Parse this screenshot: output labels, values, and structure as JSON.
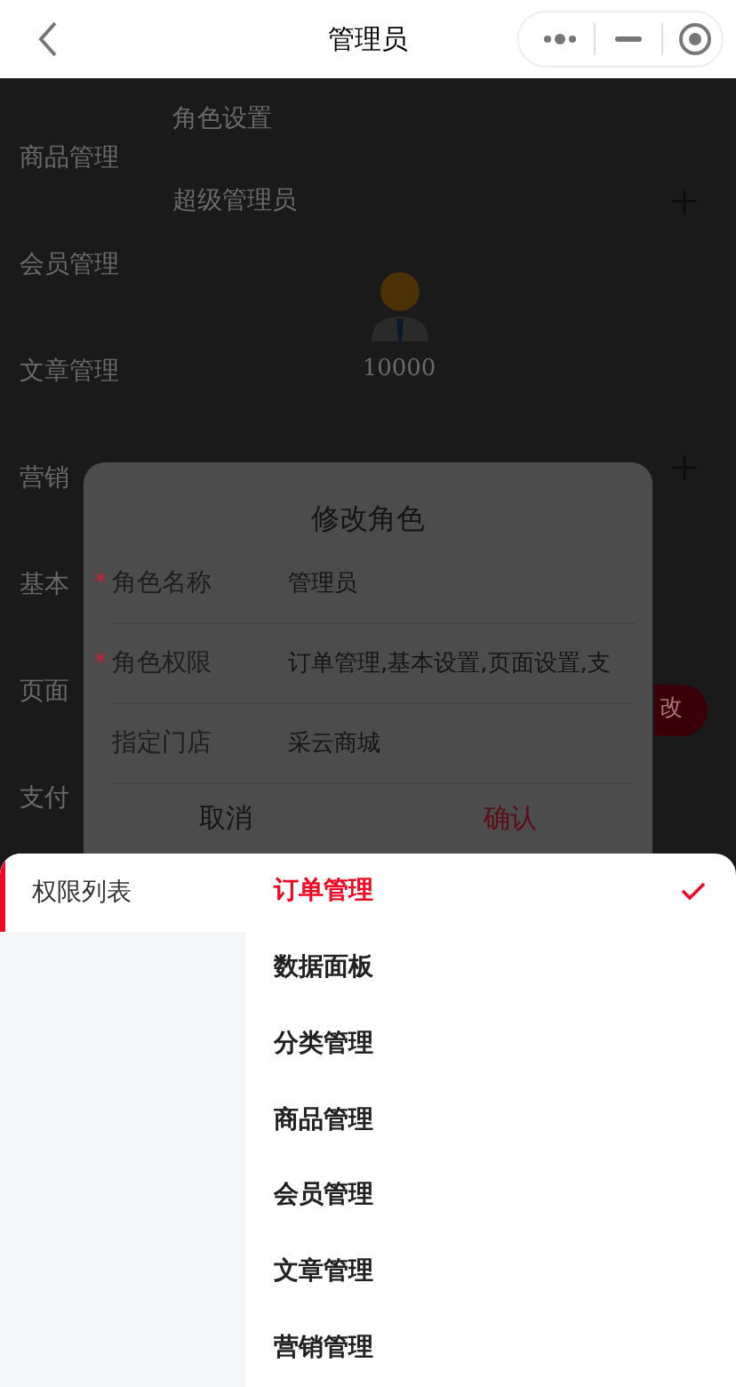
{
  "nav_bar": {
    "title": "管理员"
  },
  "background_page": {
    "sidebar_items": [
      "商品管理",
      "会员管理",
      "文章管理",
      "营销",
      "基本",
      "页面",
      "支付"
    ],
    "section_title": "角色设置",
    "role_name": "超级管理员",
    "user_id": "10000",
    "edit_button": "改"
  },
  "dialog": {
    "title": "修改角色",
    "fields": [
      {
        "label": "角色名称",
        "value": "管理员",
        "required_mark": "*"
      },
      {
        "label": "角色权限",
        "value": "订单管理,基本设置,页面设置,支",
        "required_mark": "*"
      },
      {
        "label": "指定门店",
        "value": "采云商城"
      }
    ],
    "buttons": [
      {
        "label": "取消",
        "kind": "cancel"
      },
      {
        "label": "确认",
        "kind": "confirm"
      }
    ]
  },
  "sheet": {
    "tabs": [
      {
        "label": "权限列表",
        "selected": true
      }
    ],
    "options": [
      {
        "label": "订单管理",
        "selected": true
      },
      {
        "label": "数据面板",
        "selected": false
      },
      {
        "label": "分类管理",
        "selected": false
      },
      {
        "label": "商品管理",
        "selected": false
      },
      {
        "label": "会员管理",
        "selected": false
      },
      {
        "label": "文章管理",
        "selected": false
      },
      {
        "label": "营销管理",
        "selected": false
      }
    ]
  }
}
